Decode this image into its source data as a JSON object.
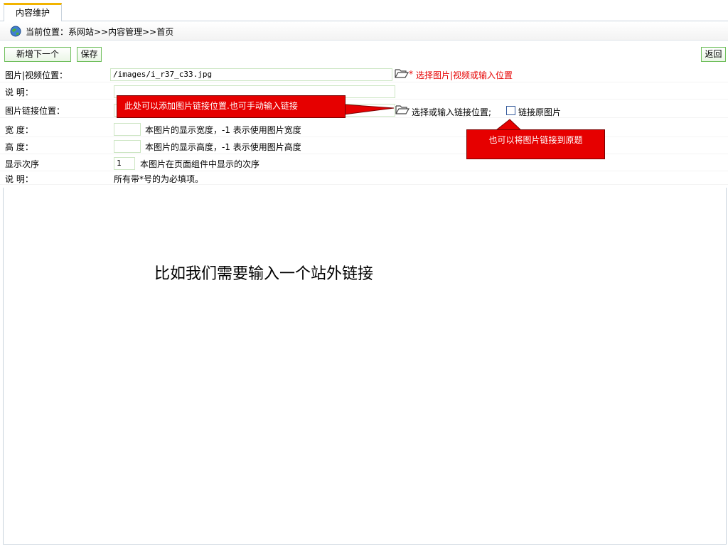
{
  "tab": {
    "label": "内容维护"
  },
  "breadcrumb": {
    "text": "当前位置：系网站>>内容管理>>首页"
  },
  "toolbar": {
    "add_next": "新增下一个",
    "save": "保存",
    "back": "返回"
  },
  "form": {
    "image_position": {
      "label": "图片|视频位置：",
      "value": "/images/i_r37_c33.jpg",
      "hint": "选择图片|视频或输入位置",
      "required_mark": "*"
    },
    "description": {
      "label": "说  明：",
      "value": ""
    },
    "link_position": {
      "label": "图片链接位置：",
      "value": "",
      "hint": "选择或输入链接位置;",
      "checkbox_label": "链接原图片"
    },
    "width": {
      "label": "宽  度：",
      "value": "",
      "hint": "本图片的显示宽度，-1 表示使用图片宽度"
    },
    "height": {
      "label": "高  度：",
      "value": "",
      "hint": "本图片的显示高度，-1 表示使用图片高度"
    },
    "order": {
      "label": "显示次序",
      "value": "1",
      "hint": "本图片在页面组件中显示的次序"
    },
    "note": {
      "label": "说  明：",
      "text": "所有带*号的为必填项。"
    }
  },
  "callouts": {
    "link_hint": "此处可以添加图片链接位置.也可手动输入链接",
    "original_hint": "也可以将图片链接到原题"
  },
  "caption": "比如我们需要输入一个站外链接",
  "colors": {
    "accent": "#f2b400",
    "required": "#e60000",
    "callout": "#e60000",
    "input_border": "#cde6c4",
    "button_border": "#6fbf5c"
  },
  "icons": {
    "breadcrumb": "globe-icon",
    "browse": "folder-open-icon"
  }
}
